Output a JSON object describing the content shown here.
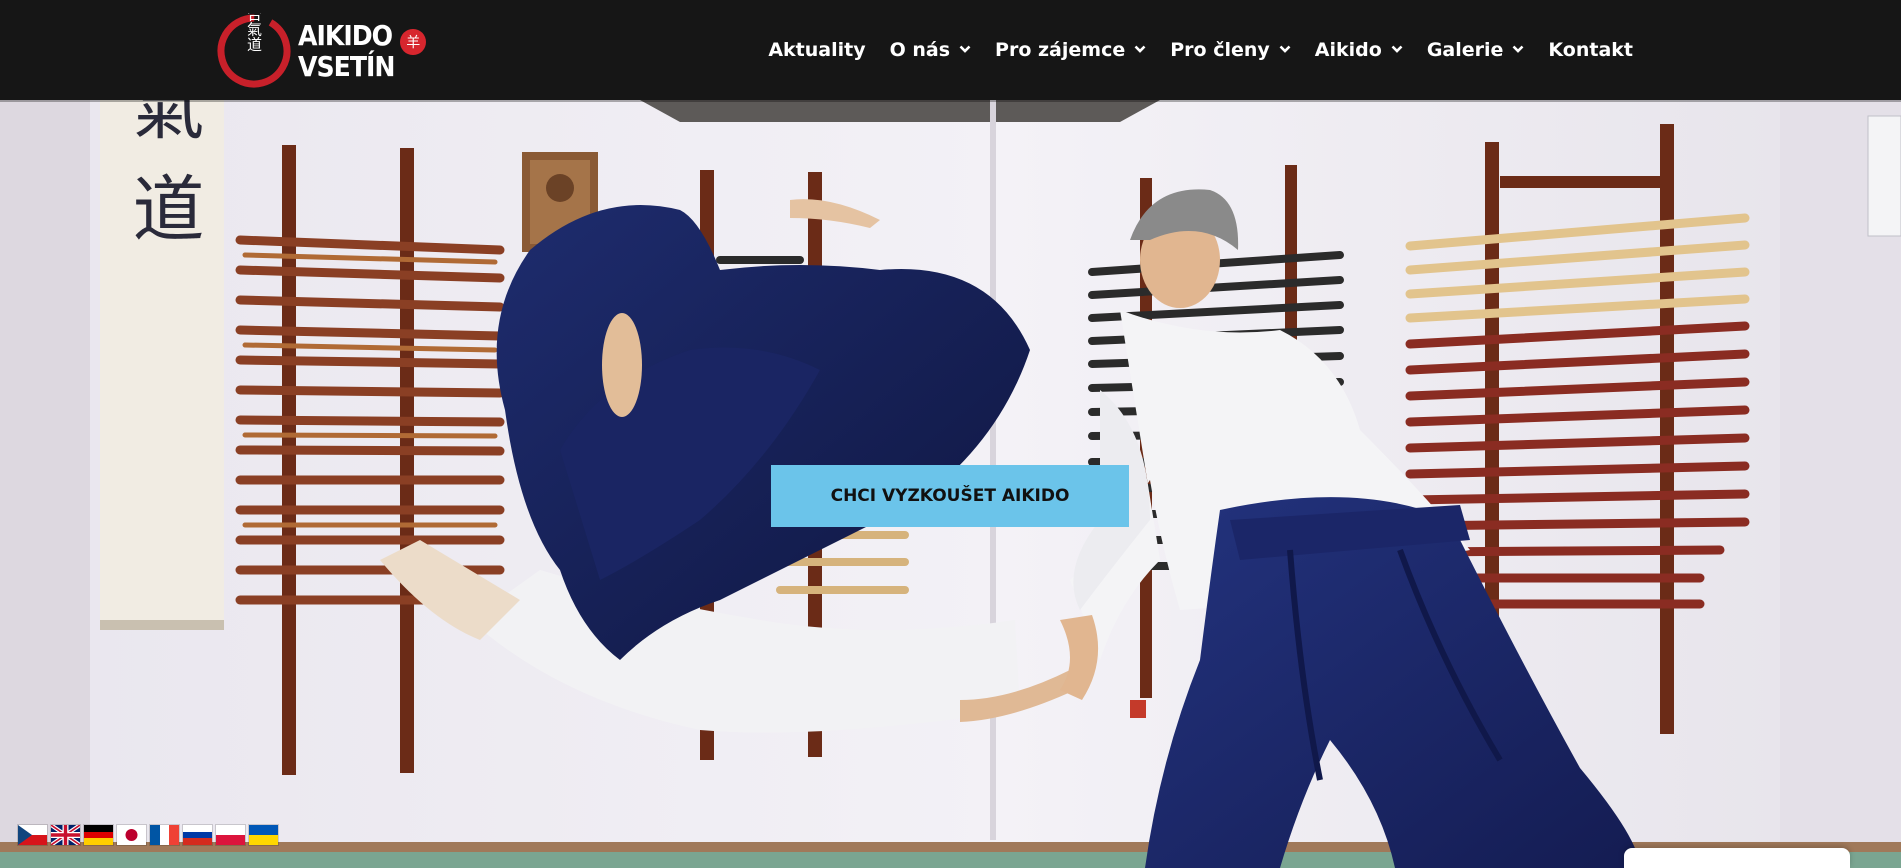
{
  "logo": {
    "line1": "AIKIDO",
    "line2": "VSETÍN",
    "seal_text": "合氣道",
    "badge_text": "羊"
  },
  "nav": {
    "items": [
      {
        "label": "Aktuality",
        "has_dropdown": false
      },
      {
        "label": "O nás",
        "has_dropdown": true
      },
      {
        "label": "Pro zájemce",
        "has_dropdown": true
      },
      {
        "label": "Pro členy",
        "has_dropdown": true
      },
      {
        "label": "Aikido",
        "has_dropdown": true
      },
      {
        "label": "Galerie",
        "has_dropdown": true
      },
      {
        "label": "Kontakt",
        "has_dropdown": false
      }
    ]
  },
  "hero": {
    "cta_label": "CHCI VYZKOUŠET AIKIDO",
    "scroll_text": "合氣道"
  },
  "languages": [
    {
      "code": "cs",
      "icon": "czech-flag-icon"
    },
    {
      "code": "en",
      "icon": "uk-flag-icon"
    },
    {
      "code": "de",
      "icon": "german-flag-icon"
    },
    {
      "code": "ja",
      "icon": "japan-flag-icon"
    },
    {
      "code": "fr",
      "icon": "france-flag-icon"
    },
    {
      "code": "ru",
      "icon": "russia-flag-icon"
    },
    {
      "code": "pl",
      "icon": "poland-flag-icon"
    },
    {
      "code": "uk",
      "icon": "ukraine-flag-icon"
    }
  ],
  "colors": {
    "header_bg": "#161616",
    "accent_red": "#d7262e",
    "cta_bg": "#6bc4ea",
    "hakama_navy": "#1c2a78",
    "weapon_wood": "#8a3f24"
  }
}
